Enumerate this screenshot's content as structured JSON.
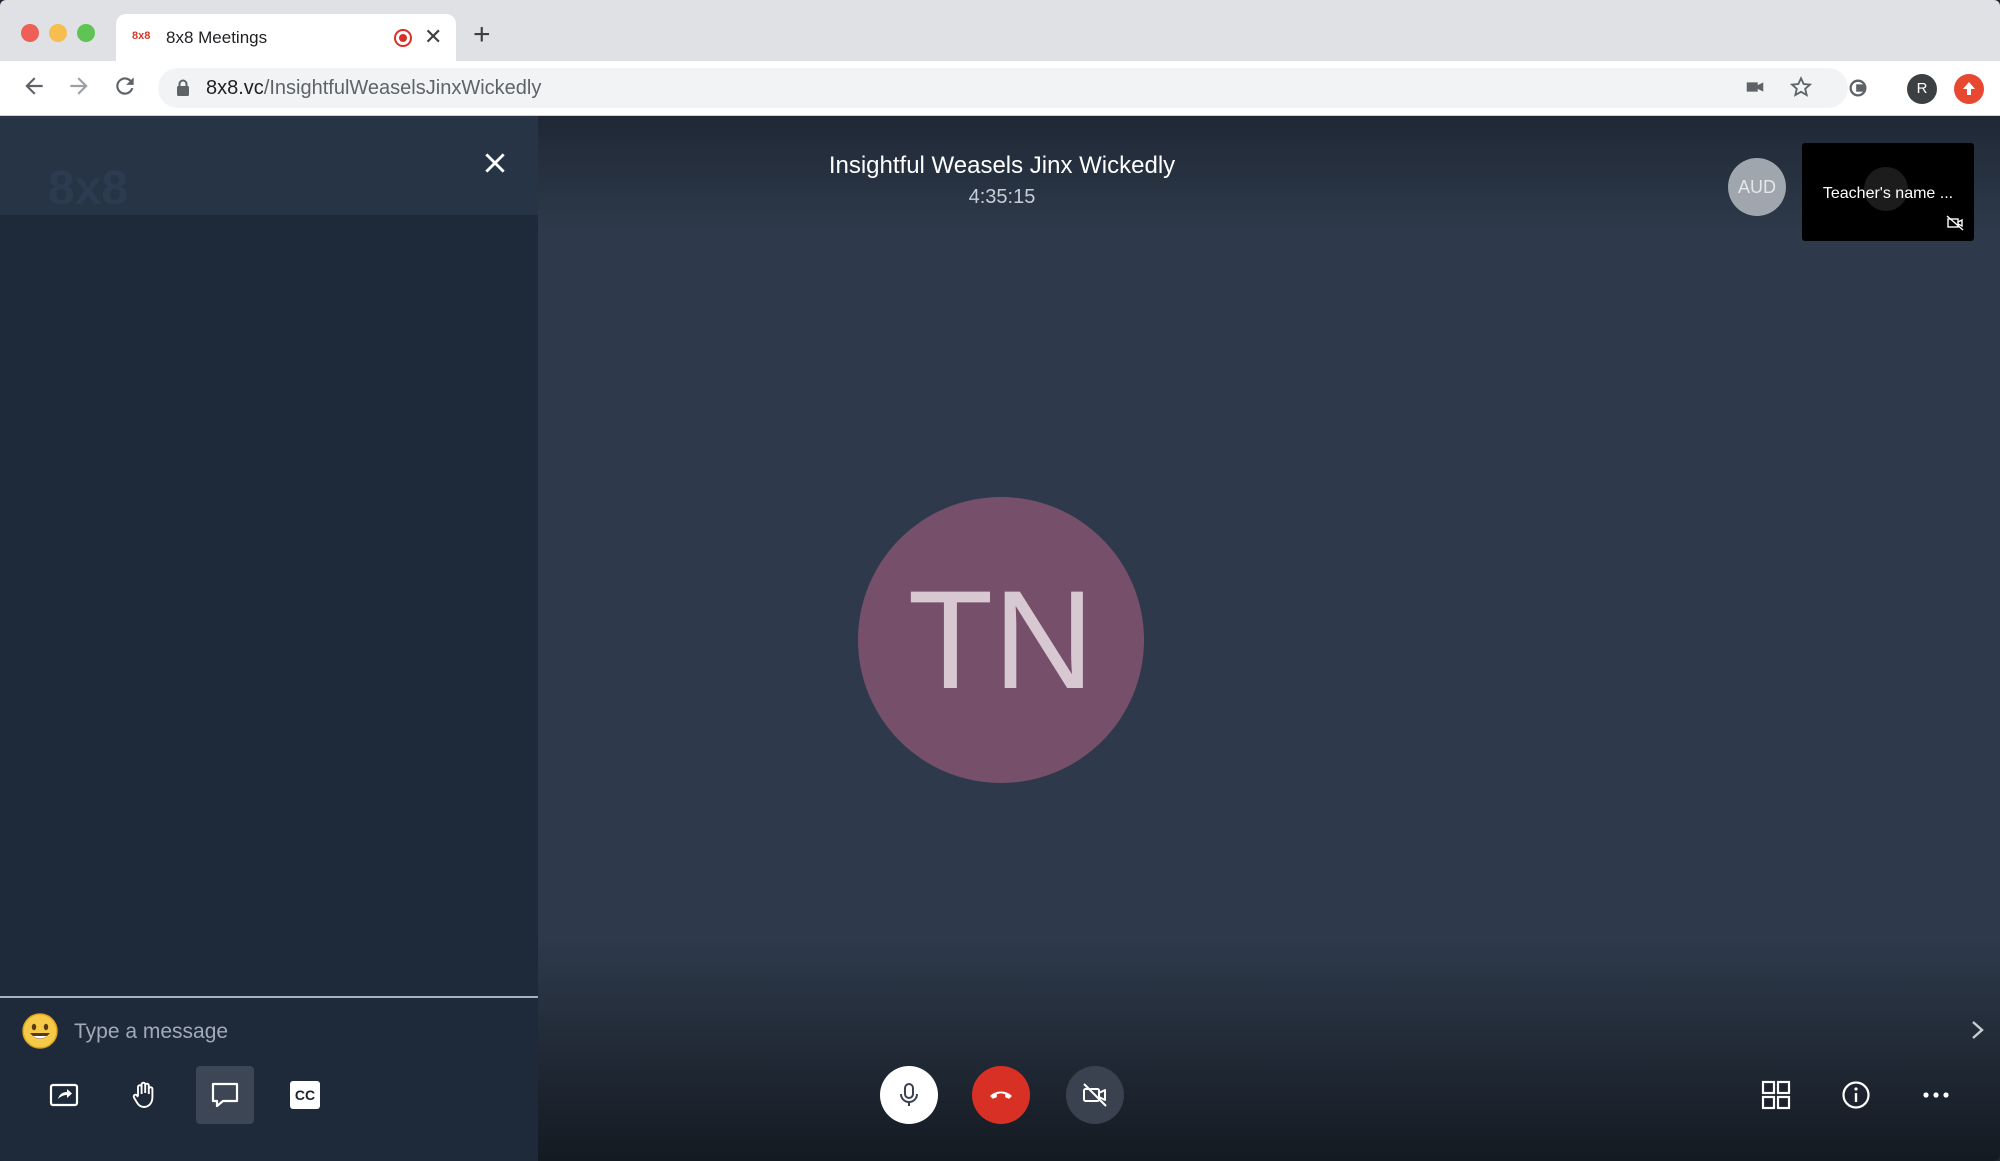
{
  "browser": {
    "tab_favicon_text": "8x8",
    "tab_title": "8x8 Meetings",
    "new_tab_symbol": "+",
    "url_host": "8x8.vc",
    "url_path": "/InsightfulWeaselsJinxWickedly",
    "profile_initial": "R",
    "icons": [
      "back-arrow-icon",
      "forward-arrow-icon",
      "reload-icon",
      "lock-icon",
      "camera-icon",
      "star-icon",
      "screen-capture-icon",
      "profile-avatar",
      "update-icon"
    ]
  },
  "chat": {
    "brand_logo": "8x8",
    "input_placeholder": "Type a message"
  },
  "meeting": {
    "title": "Insightful Weasels Jinx Wickedly",
    "timer": "4:35:15",
    "aud_badge": "AUD",
    "participant_thumb_name": "Teacher's name ...",
    "main_avatar_initials": "TN"
  },
  "toolbar": {
    "left": [
      "share-screen-icon",
      "raise-hand-icon",
      "chat-icon",
      "closed-captions-icon"
    ],
    "cc_label": "CC",
    "center": [
      "microphone-icon",
      "hang-up-icon",
      "camera-off-icon"
    ],
    "right": [
      "tile-view-icon",
      "info-icon",
      "more-options-icon"
    ]
  },
  "colors": {
    "stage_background": "#2e3a4b",
    "chat_background": "#1e2a3a",
    "avatar_background": "#76506a",
    "hangup_red": "#d93025"
  }
}
